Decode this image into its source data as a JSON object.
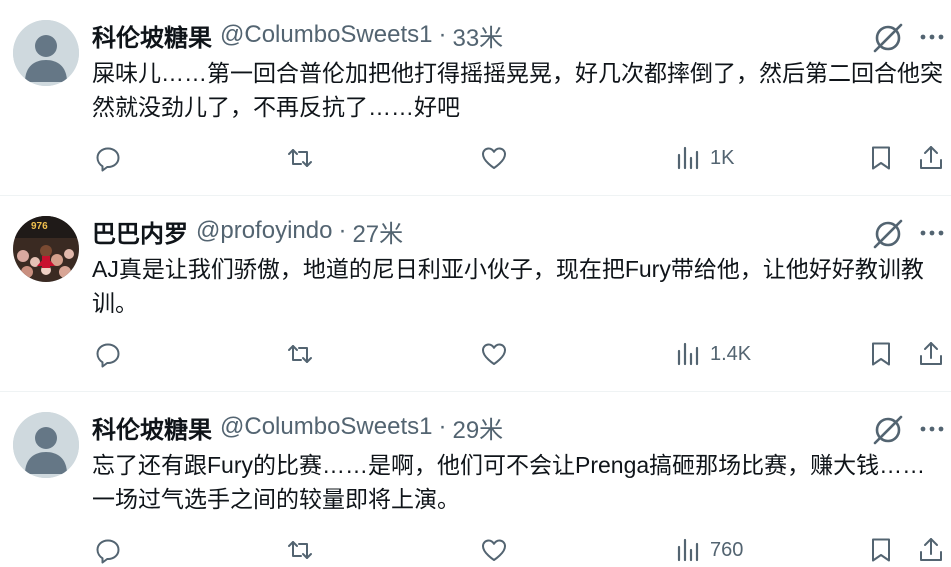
{
  "tweets": [
    {
      "name": "科伦坡糖果",
      "handle": "@ColumboSweets1",
      "separator": "·",
      "time": "33米",
      "text": "屎味儿……第一回合普伦加把他打得摇摇晃晃，好几次都摔倒了，然后第二回合他突然就没劲儿了，不再反抗了……好吧",
      "views": "1K",
      "avatar": "default-avatar-icon"
    },
    {
      "name": "巴巴内罗",
      "handle": "@profoyindo",
      "separator": "·",
      "time": "27米",
      "text": "AJ真是让我们骄傲，地道的尼日利亚小伙子，现在把Fury带给他，让他好好教训教训。",
      "views": "1.4K",
      "avatar": "photo-avatar",
      "avatar_badge": "976"
    },
    {
      "name": "科伦坡糖果",
      "handle": "@ColumboSweets1",
      "separator": "·",
      "time": "29米",
      "text": "忘了还有跟Fury的比赛……是啊，他们可不会让Prenga搞砸那场比赛，赚大钱……一场过气选手之间的较量即将上演。",
      "views": "760",
      "avatar": "default-avatar-icon"
    }
  ],
  "colors": {
    "text_primary": "#0f1419",
    "text_secondary": "#536471",
    "divider": "#eff3f4",
    "default_avatar_bg": "#cfd9de",
    "default_avatar_fg": "#657786"
  },
  "icons": [
    "reply-icon",
    "retweet-icon",
    "like-icon",
    "views-icon",
    "bookmark-icon",
    "share-icon",
    "grok-icon",
    "more-icon"
  ]
}
